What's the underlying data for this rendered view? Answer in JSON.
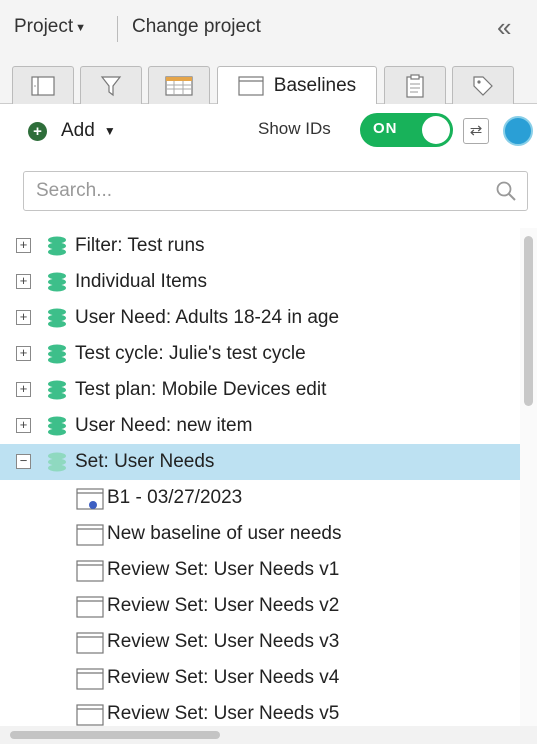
{
  "header": {
    "project_label": "Project",
    "change_project_label": "Change project",
    "collapse_glyph": "«"
  },
  "tabs": [
    {
      "name": "list-view-icon"
    },
    {
      "name": "filter-icon"
    },
    {
      "name": "grid-view-icon"
    },
    {
      "name": "baselines-icon",
      "label": "Baselines",
      "active": true
    },
    {
      "name": "clipboard-icon"
    },
    {
      "name": "tag-icon"
    }
  ],
  "toolbar": {
    "add_label": "Add",
    "show_ids_label": "Show IDs",
    "toggle_text": "ON",
    "swap_glyph": "⇄"
  },
  "search": {
    "placeholder": "Search..."
  },
  "tree": {
    "items": [
      {
        "label": "Filter: Test runs",
        "expander": "+"
      },
      {
        "label": "Individual Items",
        "expander": "+"
      },
      {
        "label": "User Need: Adults 18-24 in age",
        "expander": "+"
      },
      {
        "label": "Test cycle: Julie's test cycle",
        "expander": "+"
      },
      {
        "label": "Test plan: Mobile Devices edit",
        "expander": "+"
      },
      {
        "label": "User Need: new item",
        "expander": "+"
      },
      {
        "label": "Set: User Needs",
        "expander": "−",
        "selected": true
      }
    ],
    "children": [
      {
        "label": "B1 - 03/27/2023",
        "icon": "baseline-signed-icon"
      },
      {
        "label": "New baseline of user needs",
        "icon": "baseline-icon"
      },
      {
        "label": "Review Set: User Needs v1",
        "icon": "baseline-icon"
      },
      {
        "label": "Review Set: User Needs v2",
        "icon": "baseline-icon"
      },
      {
        "label": "Review Set: User Needs v3",
        "icon": "baseline-icon"
      },
      {
        "label": "Review Set: User Needs v4",
        "icon": "baseline-icon"
      },
      {
        "label": "Review Set: User Needs v5",
        "icon": "baseline-icon"
      }
    ]
  },
  "colors": {
    "accent_green": "#18b25a",
    "selected_row": "#bde1f2",
    "stack_icon": "#3dbf8a"
  }
}
